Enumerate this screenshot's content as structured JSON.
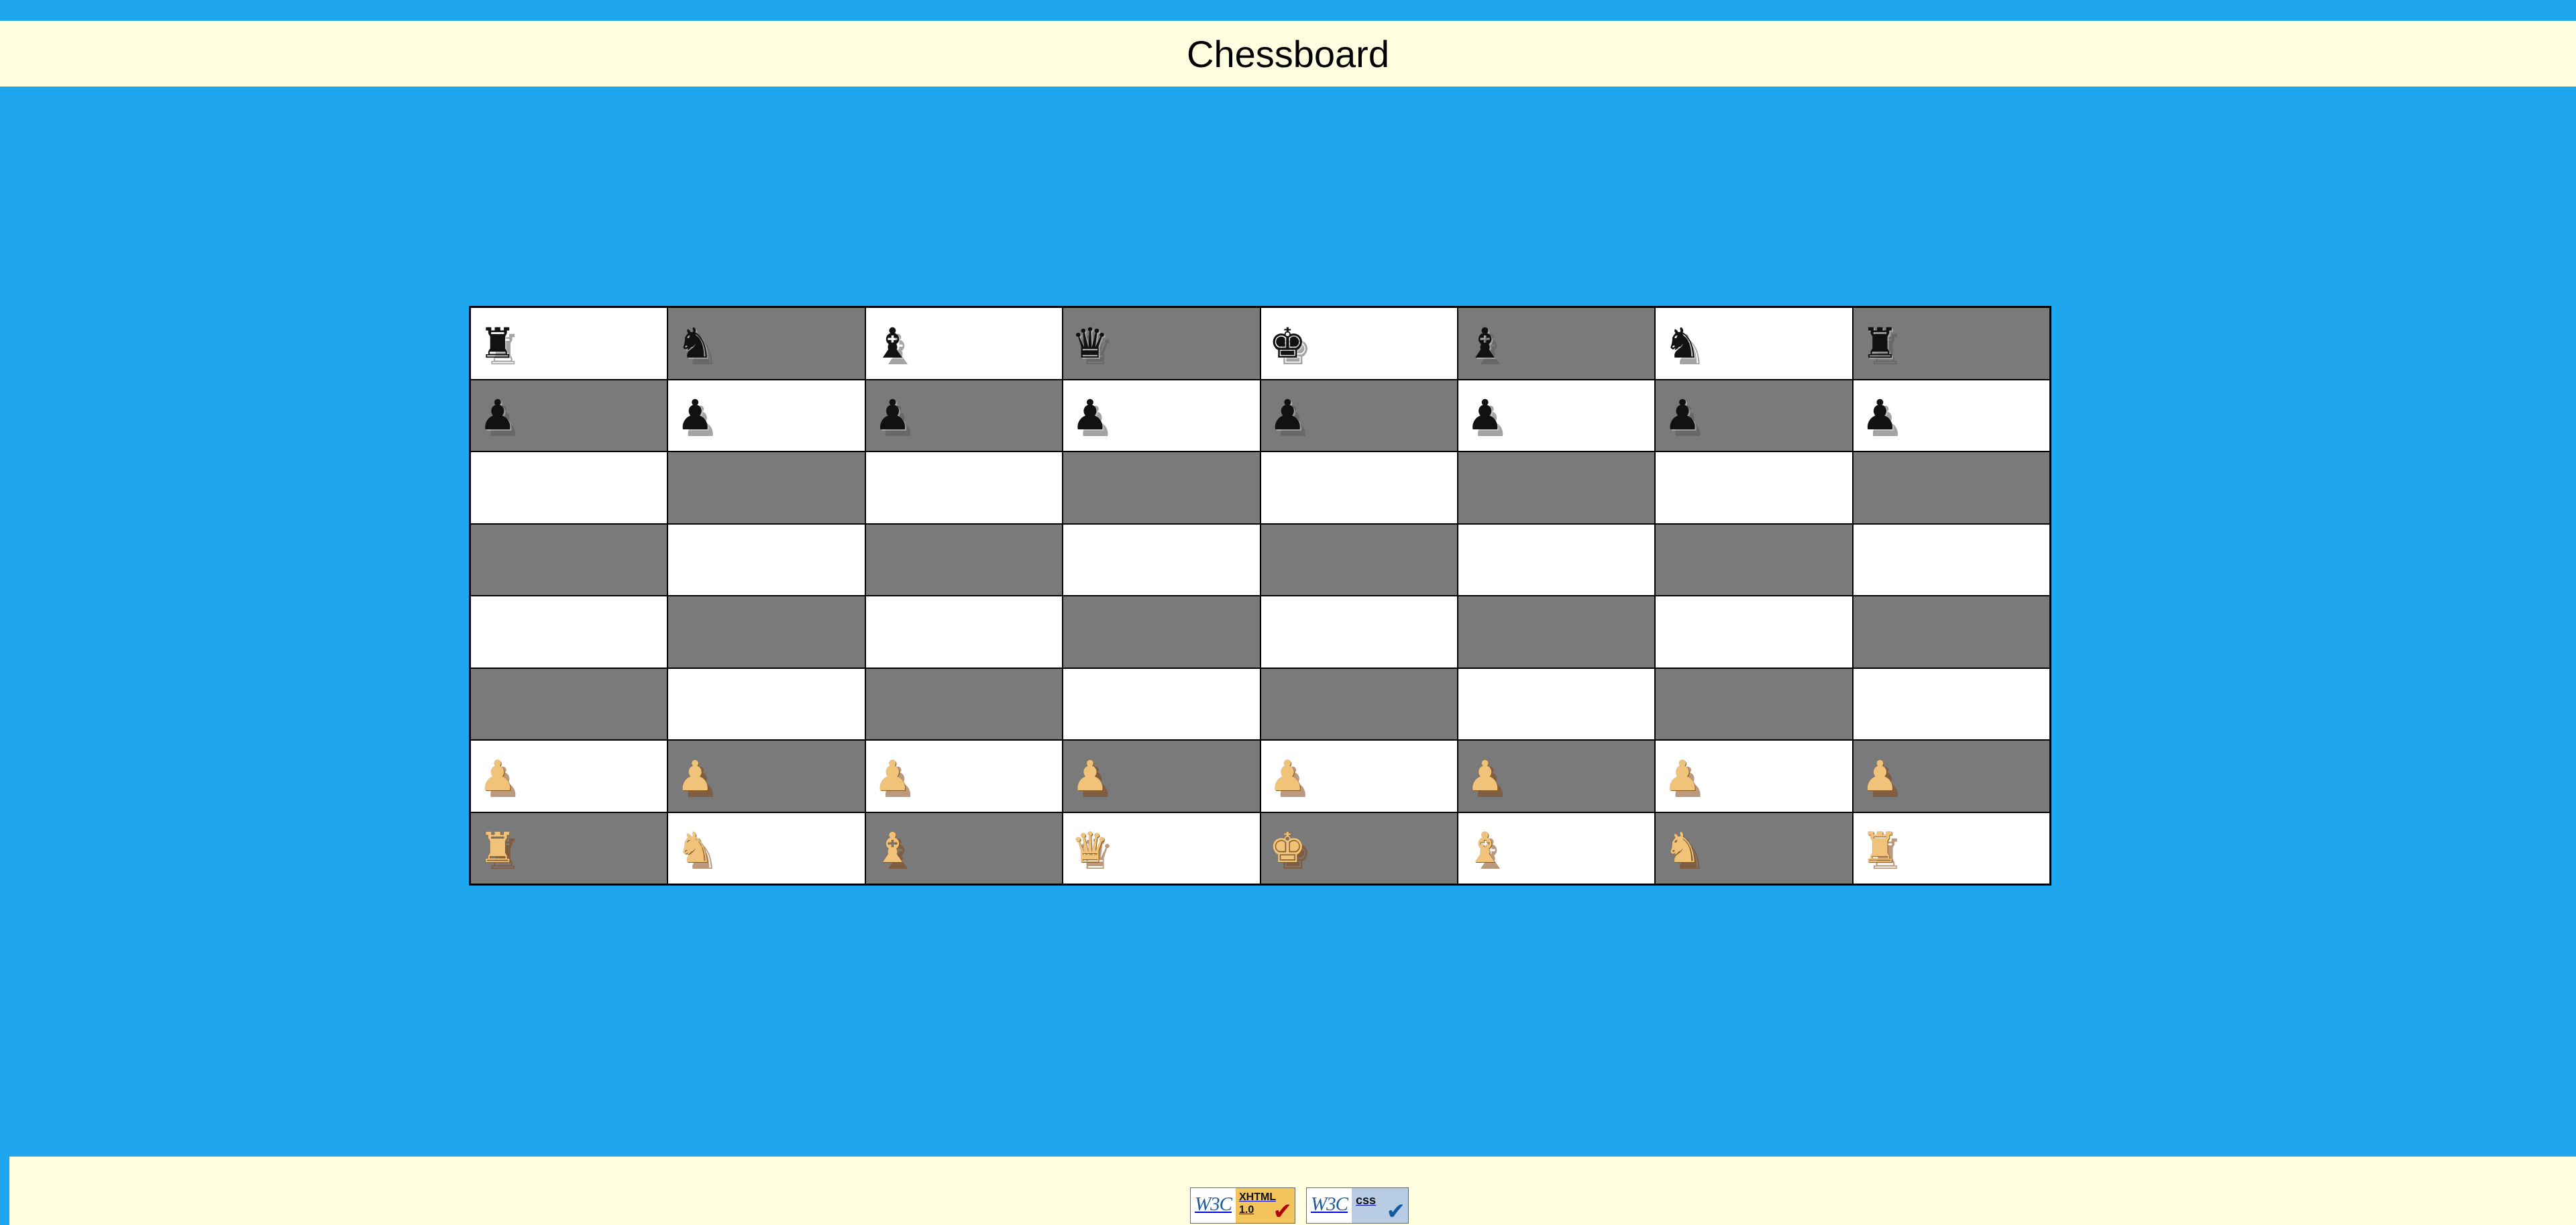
{
  "page": {
    "title": "Chessboard"
  },
  "colors": {
    "background": "#1ea6ef",
    "header_bg": "#fefee0",
    "light_square": "#ffffff",
    "dark_square": "#7a7a7a",
    "black_piece": "#111111",
    "white_piece": "#f1c37a"
  },
  "board": {
    "rows": [
      [
        "black-rook",
        "black-knight",
        "black-bishop",
        "black-queen",
        "black-king",
        "black-bishop",
        "black-knight",
        "black-rook"
      ],
      [
        "black-pawn",
        "black-pawn",
        "black-pawn",
        "black-pawn",
        "black-pawn",
        "black-pawn",
        "black-pawn",
        "black-pawn"
      ],
      [
        "",
        "",
        "",
        "",
        "",
        "",
        "",
        ""
      ],
      [
        "",
        "",
        "",
        "",
        "",
        "",
        "",
        ""
      ],
      [
        "",
        "",
        "",
        "",
        "",
        "",
        "",
        ""
      ],
      [
        "",
        "",
        "",
        "",
        "",
        "",
        "",
        ""
      ],
      [
        "white-pawn",
        "white-pawn",
        "white-pawn",
        "white-pawn",
        "white-pawn",
        "white-pawn",
        "white-pawn",
        "white-pawn"
      ],
      [
        "white-rook",
        "white-knight",
        "white-bishop",
        "white-queen",
        "white-king",
        "white-bishop",
        "white-knight",
        "white-rook"
      ]
    ],
    "glyphs": {
      "black-king": "♚",
      "black-queen": "♛",
      "black-rook": "♜",
      "black-bishop": "♝",
      "black-knight": "♞",
      "black-pawn": "♟",
      "white-king": "♚",
      "white-queen": "♛",
      "white-rook": "♜",
      "white-bishop": "♝",
      "white-knight": "♞",
      "white-pawn": "♟"
    }
  },
  "footer": {
    "badges": [
      {
        "name": "w3c-xhtml-badge",
        "w3c_text": "W3C",
        "kind_lines": [
          "XHTML",
          "1.0"
        ],
        "icon": "check-icon"
      },
      {
        "name": "w3c-css-badge",
        "w3c_text": "W3C",
        "kind_lines": [
          "css"
        ],
        "icon": "check-icon"
      }
    ]
  }
}
